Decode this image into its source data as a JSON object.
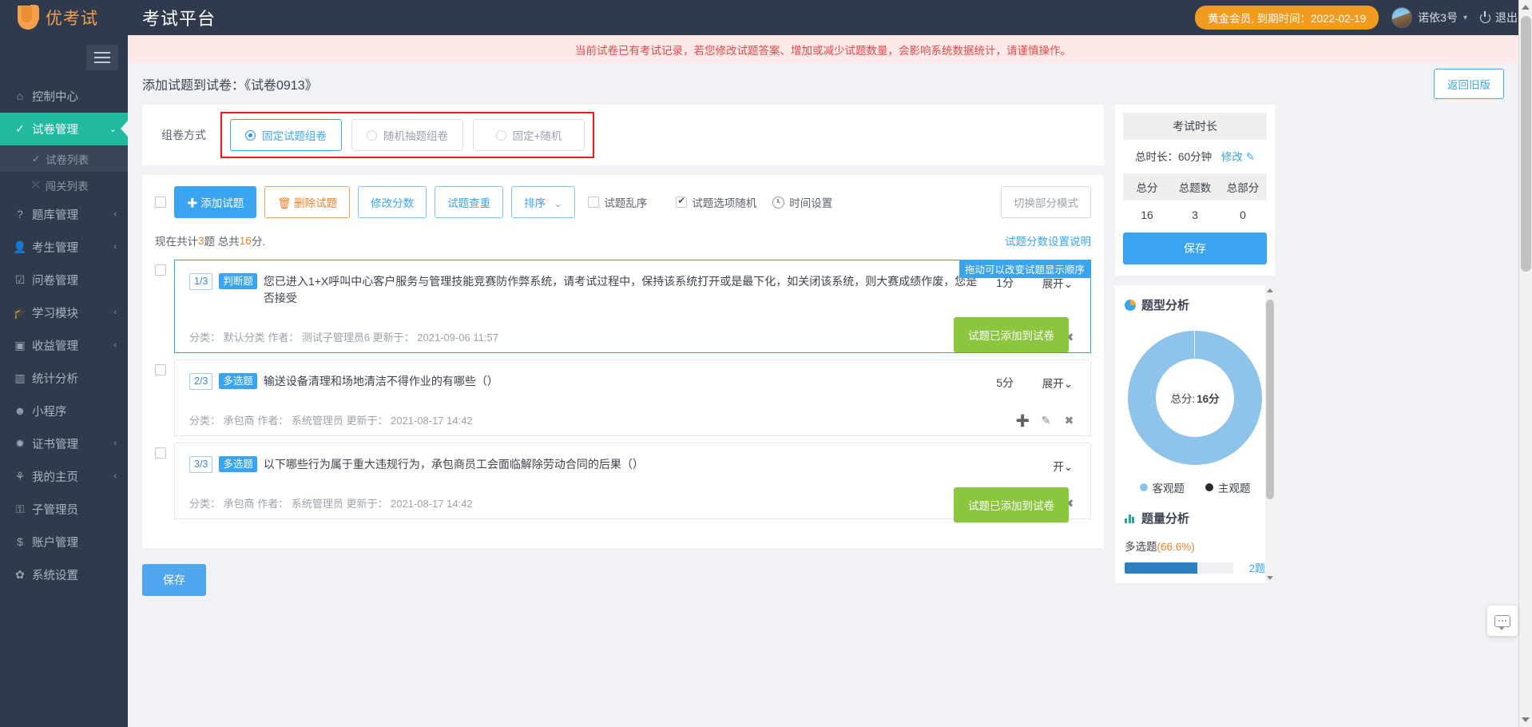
{
  "topbar": {
    "brand": "优考试",
    "app_title": "考试平台",
    "vip_badge": "黄金会员, 到期时间：2022-02-19",
    "user_name": "诺依3号",
    "logout": "退出"
  },
  "sidebar": {
    "items": [
      {
        "icon": "home-icon",
        "glyph": "⌂",
        "label": "控制中心",
        "arrow": "",
        "active": false
      },
      {
        "icon": "check-circle-icon",
        "glyph": "✓",
        "label": "试卷管理",
        "arrow": "⌄",
        "active": true
      },
      {
        "icon": "question-circle-icon",
        "glyph": "?",
        "label": "题库管理",
        "arrow": "‹",
        "active": false
      },
      {
        "icon": "user-icon",
        "glyph": "👤",
        "label": "考生管理",
        "arrow": "‹",
        "active": false
      },
      {
        "icon": "checkbox-icon",
        "glyph": "☑",
        "label": "问卷管理",
        "arrow": "",
        "active": false
      },
      {
        "icon": "graduation-cap-icon",
        "glyph": "🎓",
        "label": "学习模块",
        "arrow": "‹",
        "active": false
      },
      {
        "icon": "money-icon",
        "glyph": "▣",
        "label": "收益管理",
        "arrow": "‹",
        "active": false
      },
      {
        "icon": "chart-bar-icon",
        "glyph": "▥",
        "label": "统计分析",
        "arrow": "",
        "active": false
      },
      {
        "icon": "wechat-icon",
        "glyph": "☻",
        "label": "小程序",
        "arrow": "",
        "active": false
      },
      {
        "icon": "certificate-icon",
        "glyph": "✹",
        "label": "证书管理",
        "arrow": "‹",
        "active": false
      },
      {
        "icon": "leaf-icon",
        "glyph": "⚘",
        "label": "我的主页",
        "arrow": "‹",
        "active": false
      },
      {
        "icon": "lock-user-icon",
        "glyph": "⚿",
        "label": "子管理员",
        "arrow": "",
        "active": false
      },
      {
        "icon": "dollar-icon",
        "glyph": "$",
        "label": "账户管理",
        "arrow": "",
        "active": false
      },
      {
        "icon": "gear-icon",
        "glyph": "✿",
        "label": "系统设置",
        "arrow": "",
        "active": false
      }
    ],
    "subitems": [
      {
        "icon": "check-circle-small-icon",
        "glyph": "✓",
        "label": "试卷列表",
        "selected": true
      },
      {
        "icon": "shuffle-icon",
        "glyph": "⤫",
        "label": "闯关列表",
        "selected": false
      }
    ]
  },
  "alert": {
    "text": "当前试卷已有考试记录，若您修改试题答案、增加或减少试题数量，会影响系统数据统计，请谨慎操作。"
  },
  "page": {
    "title": "添加试题到试卷：《试卷0913》",
    "back_old_button": "返回旧版"
  },
  "mode": {
    "label": "组卷方式",
    "options": [
      {
        "label": "固定试题组卷",
        "selected": true
      },
      {
        "label": "随机抽题组卷",
        "selected": false
      },
      {
        "label": "固定+随机",
        "selected": false
      }
    ]
  },
  "toolbar": {
    "add_question": "添加试题",
    "delete_question": "删除试题",
    "modify_score": "修改分数",
    "check_duplicate": "试题查重",
    "sort": "排序",
    "shuffle_questions": "试题乱序",
    "shuffle_questions_checked": false,
    "shuffle_options": "试题选项随机",
    "shuffle_options_checked": true,
    "time_settings": "时间设置",
    "switch_part_mode": "切换部分模式"
  },
  "summary": {
    "prefix": "现在共计",
    "count": "3",
    "middle": "题 总共",
    "score": "16",
    "suffix": "分.",
    "score_help_link": "试题分数设置说明"
  },
  "tooltips": {
    "drag_hint": "拖动可以改变试题显示顺序",
    "added_to_paper": "试题已添加到试卷"
  },
  "questions": [
    {
      "index": "1/3",
      "type": "判断题",
      "text": "您已进入1+X呼叫中心客户服务与管理技能竞赛防作弊系统，请考试过程中，保持该系统打开或是最下化，如关闭该系统，则大赛成绩作废，您是否接受",
      "score": "1分",
      "expand": "展开",
      "category_label": "分类：",
      "category": "默认分类",
      "author_label": "作者：",
      "author": "测试子管理员6",
      "updated_label": "更新于：",
      "updated": "2021-09-06 11:57",
      "selected": true,
      "show_drag_tip": true,
      "show_added_tip": true
    },
    {
      "index": "2/3",
      "type": "多选题",
      "text": "输送设备清理和场地清洁不得作业的有哪些（）",
      "score": "5分",
      "expand": "展开",
      "category_label": "分类：",
      "category": "承包商",
      "author_label": "作者：",
      "author": "系统管理员",
      "updated_label": "更新于：",
      "updated": "2021-08-17 14:42",
      "selected": false,
      "show_drag_tip": false,
      "show_added_tip": false
    },
    {
      "index": "3/3",
      "type": "多选题",
      "text": "以下哪些行为属于重大违规行为，承包商员工会面临解除劳动合同的后果（）",
      "score": "",
      "expand": "开",
      "category_label": "分类：",
      "category": "承包商",
      "author_label": "作者：",
      "author": "系统管理员",
      "updated_label": "更新于：",
      "updated": "2021-08-17 14:42",
      "selected": false,
      "show_drag_tip": false,
      "show_added_tip": true
    }
  ],
  "bottom_save": "保存",
  "duration_panel": {
    "header": "考试时长",
    "total_label": "总时长：60分钟",
    "edit_link": "修改",
    "stat_heads": [
      "总分",
      "总题数",
      "总部分"
    ],
    "stat_values": [
      "16",
      "3",
      "0"
    ],
    "save_button": "保存"
  },
  "chart_data": [
    {
      "type": "pie",
      "title": "题型分析",
      "center_label": "总分:",
      "center_value": "16分",
      "labels": [
        "客观题",
        "主观题"
      ],
      "values": [
        16,
        0
      ],
      "colors": [
        "#8ec3ea",
        "#2b2b2b"
      ],
      "legend_position": "bottom"
    },
    {
      "type": "bar",
      "title": "题量分析",
      "orientation": "horizontal",
      "categories": [
        "多选题"
      ],
      "percent_labels": [
        "(66.6%)"
      ],
      "values": [
        66.6
      ],
      "counts": [
        "2题"
      ],
      "xlim": [
        0,
        100
      ],
      "grid": false,
      "color": "#2e7fc0"
    }
  ]
}
